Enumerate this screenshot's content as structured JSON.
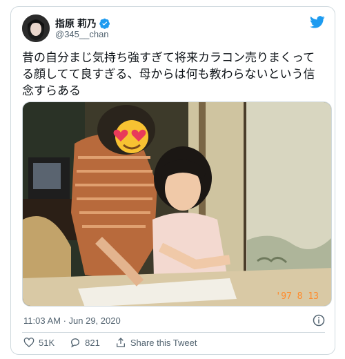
{
  "user": {
    "display_name": "指原 莉乃",
    "handle": "@345__chan",
    "avatar": "avatar-photo",
    "verified_icon": "verified-badge-icon"
  },
  "brand": {
    "icon": "twitter-bird-icon",
    "color": "#1d9bf0"
  },
  "tweet": {
    "text": "昔の自分まじ気持ち強すぎて将来カラコン売りまくってる顔してて良すぎる、母からは何も教わらないという信念すらある",
    "photo_date_stamp": "'97 8 13",
    "timestamp": "11:03 AM · Jun 29, 2020"
  },
  "actions": {
    "like_count": "51K",
    "reply_count": "821",
    "share_label": "Share this Tweet"
  },
  "colors": {
    "text": "#0f1419",
    "secondary": "#536471",
    "border": "#cfd9de",
    "stamp": "#ff8a2a"
  }
}
